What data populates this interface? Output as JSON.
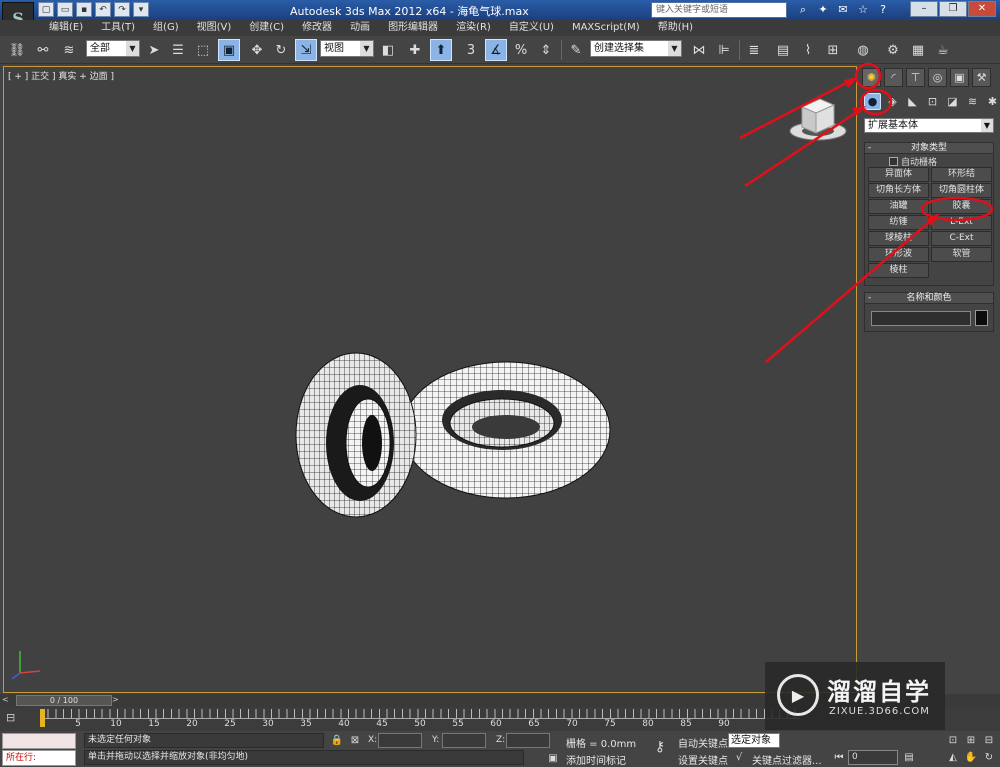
{
  "app": {
    "logo_text": "S",
    "title": "Autodesk 3ds Max  2012 x64  -  海龟气球.max",
    "search_placeholder": "键入关键字或短语"
  },
  "quick_access": [
    "new-icon",
    "open-icon",
    "save-icon",
    "undo-icon",
    "redo-icon",
    "dropdown-icon"
  ],
  "title_tools": [
    "binoculars-icon",
    "tools-icon",
    "communication-icon",
    "star-icon",
    "help-icon"
  ],
  "window_controls": {
    "minimize": "–",
    "restore": "❐",
    "close": "✕",
    "help": "?"
  },
  "menu": [
    "编辑(E)",
    "工具(T)",
    "组(G)",
    "视图(V)",
    "创建(C)",
    "修改器",
    "动画",
    "图形编辑器",
    "渲染(R)",
    "自定义(U)",
    "MAXScript(M)",
    "帮助(H)"
  ],
  "toolbar": {
    "selection_filter": "全部",
    "ref_coord": "视图",
    "named_selection": "创建选择集",
    "snap_label": "3",
    "percent_label": "%"
  },
  "viewport": {
    "label": "[ + ] 正交 ] 真实 + 边面 ]"
  },
  "command_panel": {
    "category": "扩展基本体",
    "object_type_title": "对象类型",
    "autogrid_label": "自动栅格",
    "object_buttons": [
      "异面体",
      "环形结",
      "切角长方体",
      "切角圆柱体",
      "油罐",
      "胶囊",
      "纺锤",
      "L-Ext",
      "球棱柱",
      "C-Ext",
      "环形波",
      "软管",
      "棱柱"
    ],
    "name_color_title": "名称和颜色",
    "swatch_color": "#0c0c0c"
  },
  "time_slider": {
    "position": "0 / 100",
    "left_arrow": "<",
    "right_arrow": ">"
  },
  "track_ticks": [
    "5",
    "10",
    "15",
    "20",
    "25",
    "30",
    "35",
    "40",
    "45",
    "50",
    "55",
    "60",
    "65",
    "70",
    "75",
    "80",
    "85",
    "90"
  ],
  "status": {
    "maxscript_label": "所在行:",
    "selection_text": "未选定任何对象",
    "prompt_text": "单击并拖动以选择并缩放对象(非均匀地)",
    "x_label": "X:",
    "y_label": "Y:",
    "z_label": "Z:",
    "grid_text": "栅格 = 0.0mm",
    "add_time_tag": "添加时间标记",
    "auto_key": "自动关键点",
    "set_key": "设置关键点",
    "anim_select": "选定对象",
    "key_filters": "关键点过滤器...",
    "frame_value": "0"
  },
  "watermark": {
    "name": "溜溜自学",
    "url": "ZIXUE.3D66.COM"
  },
  "colors": {
    "annotation_red": "#e0101a",
    "viewport_border": "#c79a3c",
    "active_blue": "#8ab4e6"
  }
}
